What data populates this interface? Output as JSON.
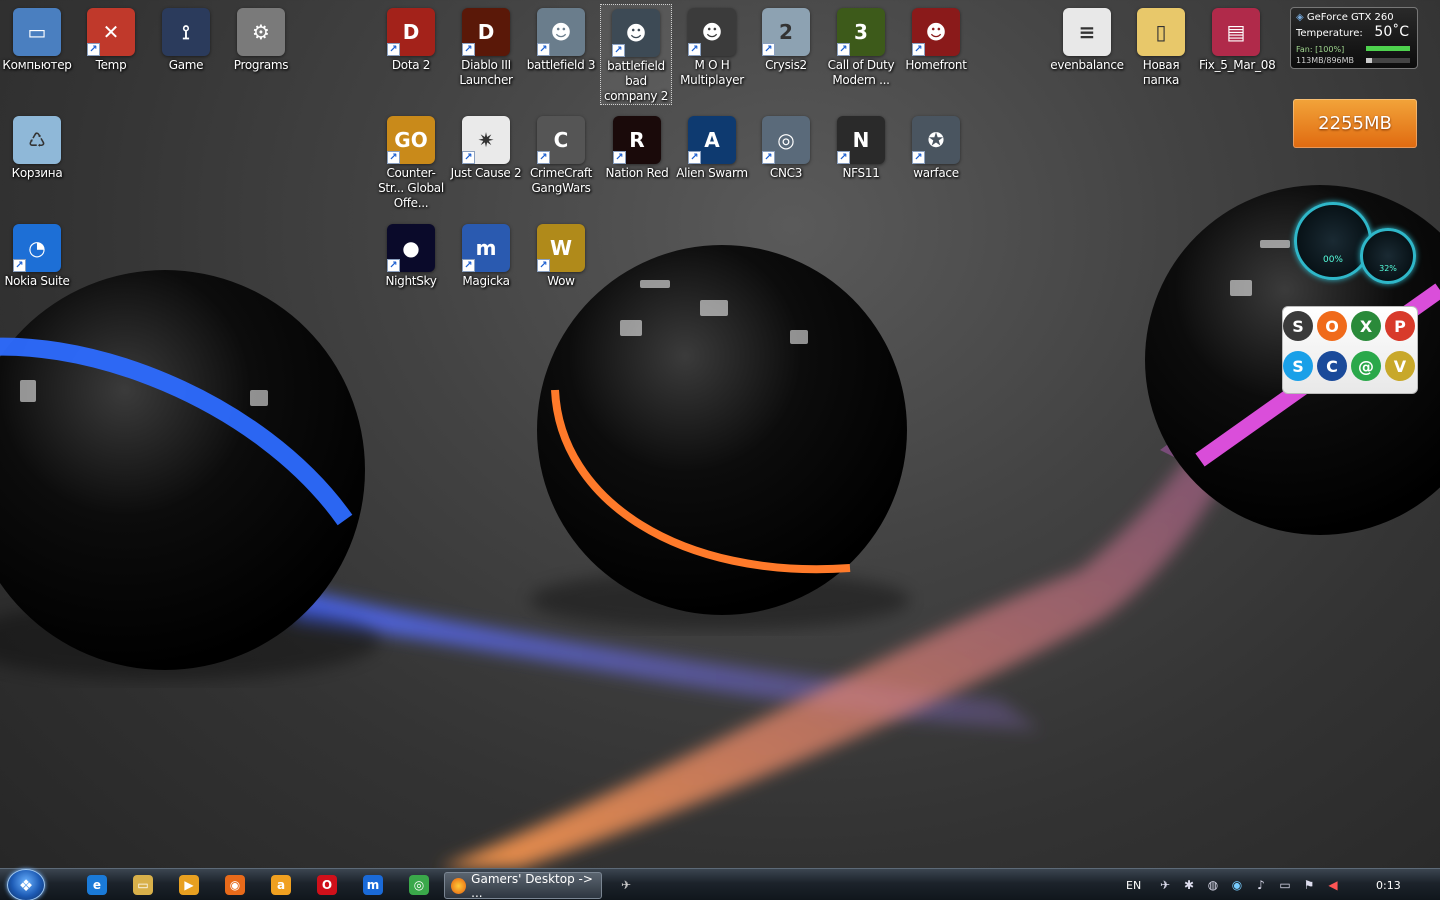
{
  "desktop": {
    "icons": [
      {
        "label": "Компьютер",
        "icon": "computer-icon",
        "color": "#4a7fc0",
        "glyph": "▭"
      },
      {
        "label": "Temp",
        "icon": "temp-folder-icon",
        "color": "#c0392b",
        "glyph": "✕"
      },
      {
        "label": "Game",
        "icon": "joystick-icon",
        "color": "#2b3b5c",
        "glyph": "⟟"
      },
      {
        "label": "Programs",
        "icon": "gears-icon",
        "color": "#7a7a7a",
        "glyph": "⚙"
      },
      {
        "label": "Корзина",
        "icon": "recycle-bin-icon",
        "color": "#8fb8d8",
        "glyph": "♺"
      },
      {
        "label": "Nokia Suite",
        "icon": "nokia-suite-icon",
        "color": "#1d6fd6",
        "glyph": "◔"
      },
      {
        "label": "Dota 2",
        "icon": "dota2-icon",
        "color": "#a3221a",
        "glyph": "D"
      },
      {
        "label": "Diablo III Launcher",
        "icon": "diablo3-icon",
        "color": "#5a1808",
        "glyph": "D"
      },
      {
        "label": "battlefield 3",
        "icon": "battlefield3-icon",
        "color": "#6a7d8c",
        "glyph": "☻"
      },
      {
        "label": "battlefield bad company 2",
        "icon": "bad-company2-icon",
        "color": "#3d4a55",
        "glyph": "☻"
      },
      {
        "label": "M O H Multiplayer",
        "icon": "moh-icon",
        "color": "#3b3b3b",
        "glyph": "☻"
      },
      {
        "label": "Crysis2",
        "icon": "crysis2-icon",
        "color": "#8da2b2",
        "glyph": "2"
      },
      {
        "label": "Call of Duty Modern ...",
        "icon": "call-of-duty-icon",
        "color": "#3d5a1a",
        "glyph": "3"
      },
      {
        "label": "Homefront",
        "icon": "homefront-icon",
        "color": "#8a1a1a",
        "glyph": "☻"
      },
      {
        "label": "Counter-Str... Global Offe...",
        "icon": "csgo-icon",
        "color": "#c98a1a",
        "glyph": "GO"
      },
      {
        "label": "Just Cause 2",
        "icon": "just-cause2-icon",
        "color": "#eaeaea",
        "glyph": "✷"
      },
      {
        "label": "CrimeCraft GangWars",
        "icon": "crimecraft-icon",
        "color": "#555555",
        "glyph": "C"
      },
      {
        "label": "Nation Red",
        "icon": "nation-red-icon",
        "color": "#1a0a0a",
        "glyph": "R"
      },
      {
        "label": "Alien Swarm",
        "icon": "alien-swarm-icon",
        "color": "#0e3a70",
        "glyph": "A"
      },
      {
        "label": "CNC3",
        "icon": "cnc3-icon",
        "color": "#5a6a7a",
        "glyph": "◎"
      },
      {
        "label": "NFS11",
        "icon": "nfs11-icon",
        "color": "#2a2a2a",
        "glyph": "N"
      },
      {
        "label": "warface",
        "icon": "warface-icon",
        "color": "#4a5560",
        "glyph": "✪"
      },
      {
        "label": "NightSky",
        "icon": "nightsky-icon",
        "color": "#0a0a2a",
        "glyph": "●"
      },
      {
        "label": "Magicka",
        "icon": "magicka-icon",
        "color": "#2a5ab0",
        "glyph": "m"
      },
      {
        "label": "Wow",
        "icon": "wow-icon",
        "color": "#b08a1a",
        "glyph": "W"
      },
      {
        "label": "evenbalance",
        "icon": "document-icon",
        "color": "#e8e8e8",
        "glyph": "≡"
      },
      {
        "label": "Новая папка",
        "icon": "folder-icon",
        "color": "#e8c86a",
        "glyph": "▯"
      },
      {
        "label": "Fix_5_Mar_08",
        "icon": "winrar-archive-icon",
        "color": "#b02a4a",
        "glyph": "▤"
      }
    ]
  },
  "gadgets": {
    "gpu": {
      "title": "GeForce GTX 260",
      "temperature_label": "Temperature:",
      "temperature_value": "50˚C",
      "fan": "Fan: [100%]",
      "fan_fraction": 1.0,
      "memory": "113MB/896MB",
      "memory_fraction": 0.126
    },
    "ram": {
      "value": "2255MB"
    },
    "gauges": {
      "cpu": "00%",
      "second": "32%"
    },
    "launcher_apps": [
      {
        "icon": "steam-icon",
        "color": "#3a3a3a",
        "glyph": "S"
      },
      {
        "icon": "origin-icon",
        "color": "#f06a1a",
        "glyph": "O"
      },
      {
        "icon": "xfire-icon",
        "color": "#2a8a3a",
        "glyph": "X"
      },
      {
        "icon": "pidgin-icon",
        "color": "#d83a2a",
        "glyph": "P"
      },
      {
        "icon": "skype-icon",
        "color": "#1aa0e8",
        "glyph": "S"
      },
      {
        "icon": "raidcall-icon",
        "color": "#1a4a9a",
        "glyph": "C"
      },
      {
        "icon": "icq-icon",
        "color": "#2aa84a",
        "glyph": "@"
      },
      {
        "icon": "ventrilo-icon",
        "color": "#c8a82a",
        "glyph": "V"
      }
    ]
  },
  "taskbar": {
    "active_window": "Gamers' Desktop -> ...",
    "language": "EN",
    "clock": "0:13",
    "pinned": [
      {
        "icon": "internet-explorer-icon",
        "color": "#1a7ad8",
        "glyph": "e"
      },
      {
        "icon": "explorer-folder-icon",
        "color": "#d8b04a",
        "glyph": "▭"
      },
      {
        "icon": "media-player-icon",
        "color": "#e8a020",
        "glyph": "▶"
      },
      {
        "icon": "firefox-icon",
        "color": "#e86a1a",
        "glyph": "◉"
      },
      {
        "icon": "avast-icon",
        "color": "#f0a020",
        "glyph": "a"
      },
      {
        "icon": "opera-icon",
        "color": "#d0101a",
        "glyph": "O"
      },
      {
        "icon": "maxthon-icon",
        "color": "#1a6ad8",
        "glyph": "m"
      },
      {
        "icon": "chrome-icon",
        "color": "#3aa84a",
        "glyph": "◎"
      }
    ]
  },
  "colors": {
    "blue_ring": "#2d6cff",
    "orange_ring": "#ff7a2a",
    "pink_ring": "#ff5aff"
  }
}
